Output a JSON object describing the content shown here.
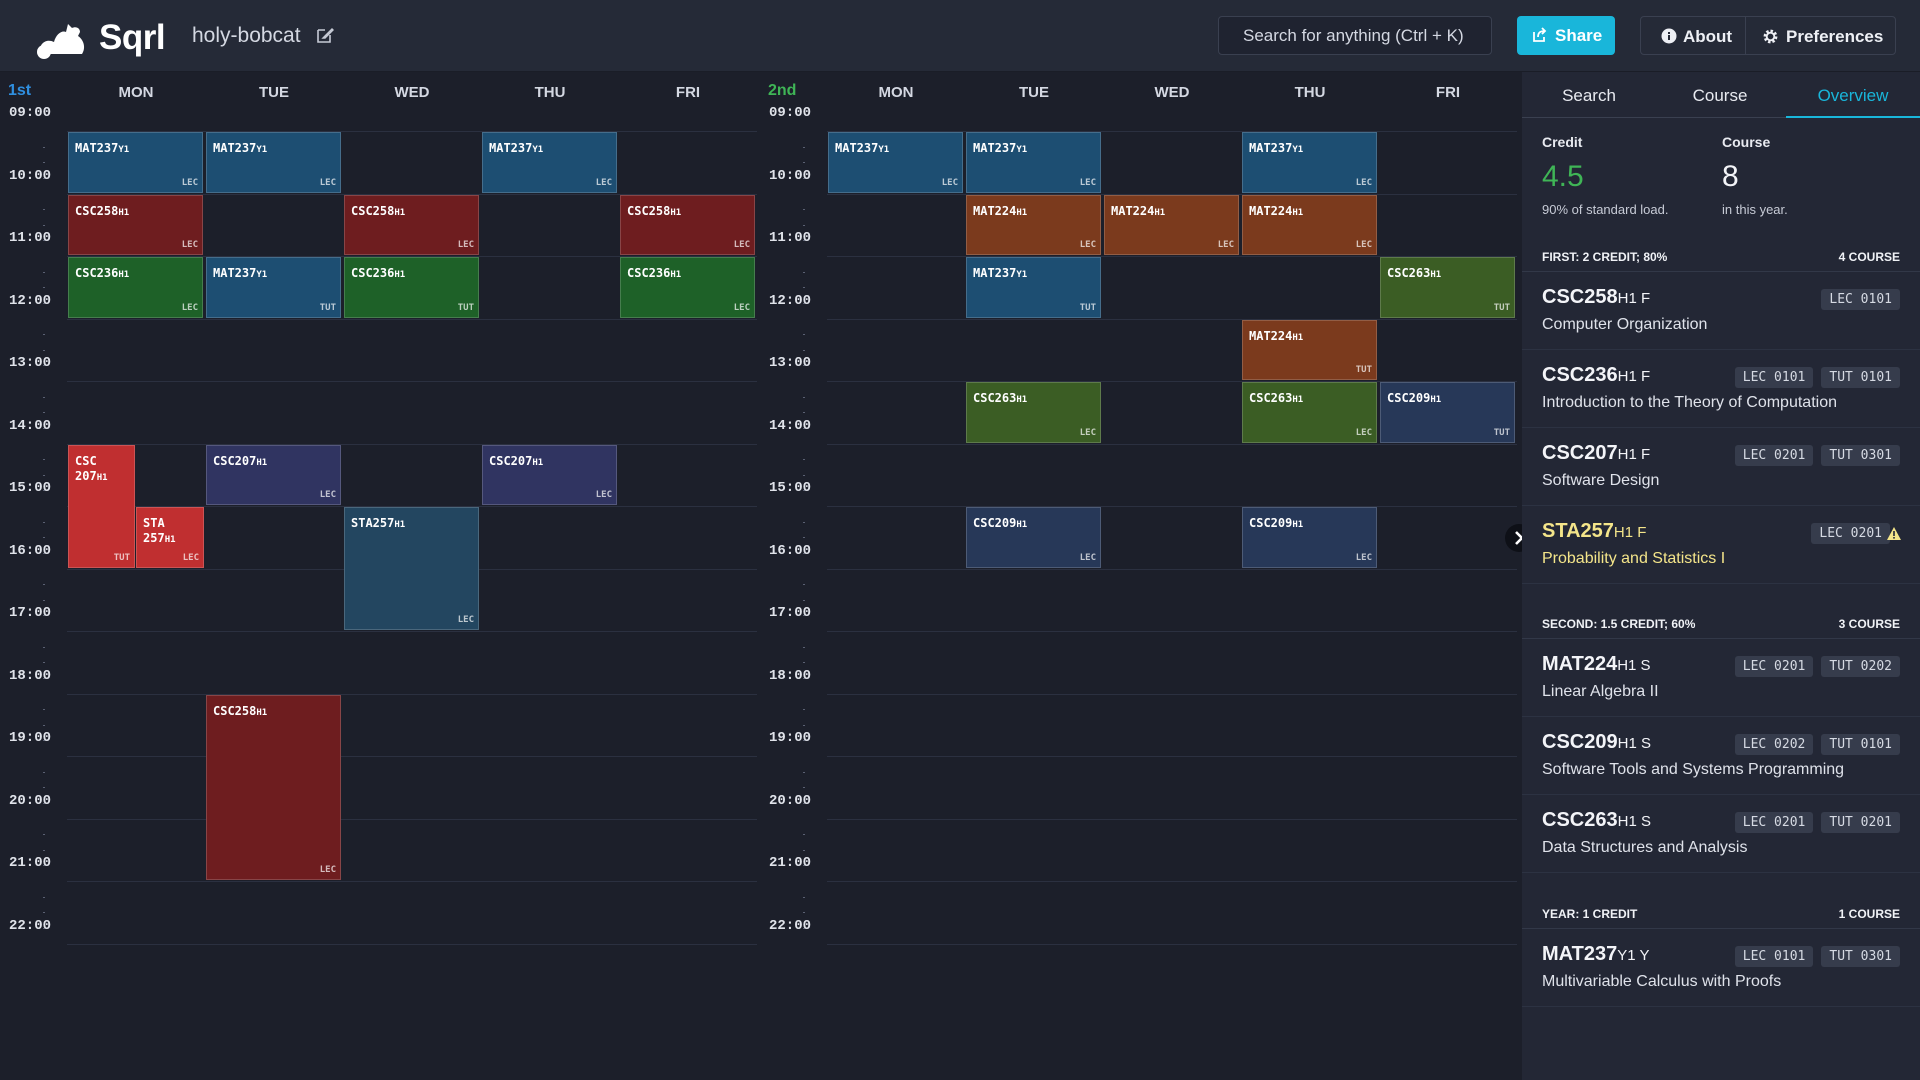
{
  "header": {
    "app_name": "Sqrl",
    "timetable_name": "holy-bobcat",
    "search_placeholder": "Search for anything (Ctrl + K)",
    "share_label": "Share",
    "about_label": "About",
    "preferences_label": "Preferences"
  },
  "days": [
    "MON",
    "TUE",
    "WED",
    "THU",
    "FRI"
  ],
  "hours": [
    "09:00",
    "10:00",
    "11:00",
    "12:00",
    "13:00",
    "14:00",
    "15:00",
    "16:00",
    "17:00",
    "18:00",
    "19:00",
    "20:00",
    "21:00",
    "22:00"
  ],
  "semesters": [
    {
      "label": "1st",
      "label_color": "#2f8fe0",
      "events": [
        {
          "code": "MAT237",
          "sect": "Y1",
          "type": "LEC",
          "day": 0,
          "start": 9,
          "end": 10,
          "color": "blue"
        },
        {
          "code": "MAT237",
          "sect": "Y1",
          "type": "LEC",
          "day": 1,
          "start": 9,
          "end": 10,
          "color": "blue"
        },
        {
          "code": "MAT237",
          "sect": "Y1",
          "type": "LEC",
          "day": 3,
          "start": 9,
          "end": 10,
          "color": "blue"
        },
        {
          "code": "CSC258",
          "sect": "H1",
          "type": "LEC",
          "day": 0,
          "start": 10,
          "end": 11,
          "color": "red"
        },
        {
          "code": "CSC258",
          "sect": "H1",
          "type": "LEC",
          "day": 2,
          "start": 10,
          "end": 11,
          "color": "red"
        },
        {
          "code": "CSC258",
          "sect": "H1",
          "type": "LEC",
          "day": 4,
          "start": 10,
          "end": 11,
          "color": "red"
        },
        {
          "code": "CSC236",
          "sect": "H1",
          "type": "LEC",
          "day": 0,
          "start": 11,
          "end": 12,
          "color": "green"
        },
        {
          "code": "MAT237",
          "sect": "Y1",
          "type": "TUT",
          "day": 1,
          "start": 11,
          "end": 12,
          "color": "blue"
        },
        {
          "code": "CSC236",
          "sect": "H1",
          "type": "TUT",
          "day": 2,
          "start": 11,
          "end": 12,
          "color": "green"
        },
        {
          "code": "CSC236",
          "sect": "H1",
          "type": "LEC",
          "day": 4,
          "start": 11,
          "end": 12,
          "color": "green"
        },
        {
          "code": "CSC 207",
          "sect": "H1",
          "type": "TUT",
          "day": 0,
          "start": 14,
          "end": 16,
          "color": "bred",
          "half": "left"
        },
        {
          "code": "STA 257",
          "sect": "H1",
          "type": "LEC",
          "day": 0,
          "start": 15,
          "end": 16,
          "color": "bred",
          "half": "right"
        },
        {
          "code": "CSC207",
          "sect": "H1",
          "type": "LEC",
          "day": 1,
          "start": 14,
          "end": 15,
          "color": "purple"
        },
        {
          "code": "CSC207",
          "sect": "H1",
          "type": "LEC",
          "day": 3,
          "start": 14,
          "end": 15,
          "color": "purple"
        },
        {
          "code": "STA257",
          "sect": "H1",
          "type": "LEC",
          "day": 2,
          "start": 15,
          "end": 17,
          "color": "steel"
        },
        {
          "code": "CSC258",
          "sect": "H1",
          "type": "LEC",
          "day": 1,
          "start": 18,
          "end": 21,
          "color": "red"
        }
      ]
    },
    {
      "label": "2nd",
      "label_color": "#3fb556",
      "events": [
        {
          "code": "MAT237",
          "sect": "Y1",
          "type": "LEC",
          "day": 0,
          "start": 9,
          "end": 10,
          "color": "blue"
        },
        {
          "code": "MAT237",
          "sect": "Y1",
          "type": "LEC",
          "day": 1,
          "start": 9,
          "end": 10,
          "color": "blue"
        },
        {
          "code": "MAT237",
          "sect": "Y1",
          "type": "LEC",
          "day": 3,
          "start": 9,
          "end": 10,
          "color": "blue"
        },
        {
          "code": "MAT224",
          "sect": "H1",
          "type": "LEC",
          "day": 1,
          "start": 10,
          "end": 11,
          "color": "orange"
        },
        {
          "code": "MAT224",
          "sect": "H1",
          "type": "LEC",
          "day": 2,
          "start": 10,
          "end": 11,
          "color": "orange"
        },
        {
          "code": "MAT224",
          "sect": "H1",
          "type": "LEC",
          "day": 3,
          "start": 10,
          "end": 11,
          "color": "orange"
        },
        {
          "code": "MAT237",
          "sect": "Y1",
          "type": "TUT",
          "day": 1,
          "start": 11,
          "end": 12,
          "color": "blue"
        },
        {
          "code": "CSC263",
          "sect": "H1",
          "type": "TUT",
          "day": 4,
          "start": 11,
          "end": 12,
          "color": "olive"
        },
        {
          "code": "MAT224",
          "sect": "H1",
          "type": "TUT",
          "day": 3,
          "start": 12,
          "end": 13,
          "color": "orange"
        },
        {
          "code": "CSC263",
          "sect": "H1",
          "type": "LEC",
          "day": 1,
          "start": 13,
          "end": 14,
          "color": "olive"
        },
        {
          "code": "CSC263",
          "sect": "H1",
          "type": "LEC",
          "day": 3,
          "start": 13,
          "end": 14,
          "color": "olive"
        },
        {
          "code": "CSC209",
          "sect": "H1",
          "type": "TUT",
          "day": 4,
          "start": 13,
          "end": 14,
          "color": "navy"
        },
        {
          "code": "CSC209",
          "sect": "H1",
          "type": "LEC",
          "day": 1,
          "start": 15,
          "end": 16,
          "color": "navy"
        },
        {
          "code": "CSC209",
          "sect": "H1",
          "type": "LEC",
          "day": 3,
          "start": 15,
          "end": 16,
          "color": "navy"
        }
      ]
    }
  ],
  "panel": {
    "tabs": [
      "Search",
      "Course",
      "Overview"
    ],
    "credit_label": "Credit",
    "credit_value": "4.5",
    "credit_note": "90% of standard load.",
    "course_label": "Course",
    "course_value": "8",
    "course_note": "in this year.",
    "accent_color": "#3fb556",
    "sections": [
      {
        "left": "FIRST: 2 CREDIT; 80%",
        "right": "4 COURSE",
        "courses": [
          {
            "code": "CSC258",
            "suffix": "H1 F",
            "title": "Computer Organization",
            "tags": [
              "LEC 0101"
            ]
          },
          {
            "code": "CSC236",
            "suffix": "H1 F",
            "title": "Introduction to the Theory of Computation",
            "tags": [
              "LEC 0101",
              "TUT 0101"
            ]
          },
          {
            "code": "CSC207",
            "suffix": "H1 F",
            "title": "Software Design",
            "tags": [
              "LEC 0201",
              "TUT 0301"
            ]
          },
          {
            "code": "STA257",
            "suffix": "H1 F",
            "title": "Probability and Statistics I",
            "tags": [
              "LEC 0201"
            ],
            "warning": true
          }
        ]
      },
      {
        "left": "SECOND: 1.5 CREDIT; 60%",
        "right": "3 COURSE",
        "courses": [
          {
            "code": "MAT224",
            "suffix": "H1 S",
            "title": "Linear Algebra II",
            "tags": [
              "LEC 0201",
              "TUT 0202"
            ]
          },
          {
            "code": "CSC209",
            "suffix": "H1 S",
            "title": "Software Tools and Systems Programming",
            "tags": [
              "LEC 0202",
              "TUT 0101"
            ]
          },
          {
            "code": "CSC263",
            "suffix": "H1 S",
            "title": "Data Structures and Analysis",
            "tags": [
              "LEC 0201",
              "TUT 0201"
            ]
          }
        ]
      },
      {
        "left": "YEAR: 1 CREDIT",
        "right": "1 COURSE",
        "courses": [
          {
            "code": "MAT237",
            "suffix": "Y1 Y",
            "title": "Multivariable Calculus with Proofs",
            "tags": [
              "LEC 0101",
              "TUT 0301"
            ]
          }
        ]
      }
    ]
  }
}
